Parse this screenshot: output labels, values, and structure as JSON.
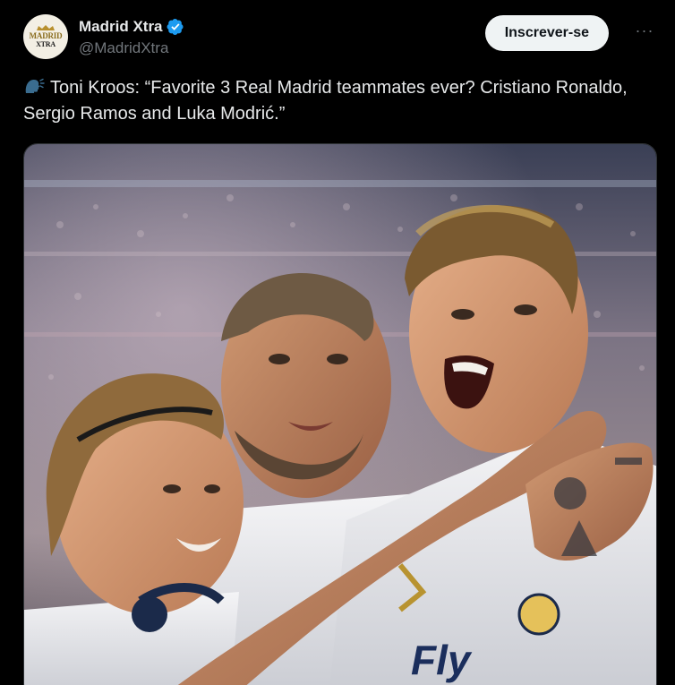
{
  "author": {
    "display_name": "Madrid Xtra",
    "handle": "@MadridXtra",
    "avatar_text_top": "MADRID",
    "avatar_text_bottom": "XTRA",
    "verified": true
  },
  "actions": {
    "subscribe_label": "Inscrever-se",
    "more_label": "···"
  },
  "tweet": {
    "emoji_icon": "speaking-head-icon",
    "text": "Toni Kroos: “Favorite 3 Real Madrid teammates ever? Cristiano Ronaldo, Sergio Ramos and Luka Modrić.”"
  },
  "media": {
    "jersey_text": "Fly",
    "image_icon": "photo-footballers-celebrating"
  },
  "colors": {
    "background": "#000000",
    "text": "#e7e9ea",
    "secondary": "#71767b",
    "verified": "#1d9bf0",
    "button_bg": "#eff3f4"
  }
}
